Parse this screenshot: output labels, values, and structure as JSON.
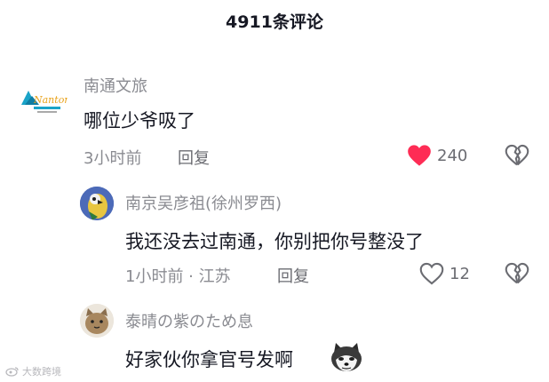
{
  "header": {
    "title": "4911条评论"
  },
  "comments": [
    {
      "username": "南通文旅",
      "avatar_text": "Nantong",
      "content": "哪位少爷吸了",
      "time": "3小时前",
      "reply_label": "回复",
      "likes": "240",
      "liked": true
    },
    {
      "username": "南京吴彦祖(徐州罗西)",
      "content": "我还没去过南通，你别把你号整没了",
      "time": "1小时前 · 江苏",
      "reply_label": "回复",
      "likes": "12",
      "liked": false
    },
    {
      "username": "泰晴の紫のため息",
      "content": "好家伙你拿官号发啊"
    }
  ],
  "watermark": {
    "text": "大数跨境"
  },
  "colors": {
    "like_active": "#fe2c55",
    "secondary_text": "#8a8b91",
    "primary_text": "#161823"
  }
}
